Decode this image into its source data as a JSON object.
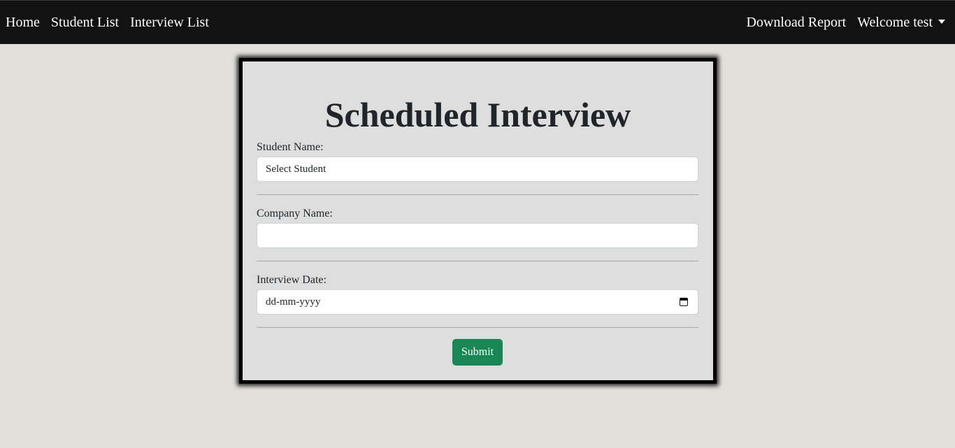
{
  "navbar": {
    "left_links": [
      "Home",
      "Student List",
      "Interview List"
    ],
    "download_report": "Download Report",
    "user_menu": "Welcome test"
  },
  "form": {
    "title": "Scheduled Interview",
    "student": {
      "label": "Student Name:",
      "selected": "Select Student"
    },
    "company": {
      "label": "Company Name:",
      "value": ""
    },
    "date": {
      "label": "Interview Date:",
      "placeholder": "dd-mm-yyyy"
    },
    "submit_label": "Submit"
  },
  "colors": {
    "navbar_bg": "#121212",
    "page_bg": "#e3e0dc",
    "card_bg": "#dedede",
    "submit_bg": "#198754"
  },
  "icons": {
    "date_picker": "calendar-icon",
    "user_menu": "chevron-down-icon"
  }
}
